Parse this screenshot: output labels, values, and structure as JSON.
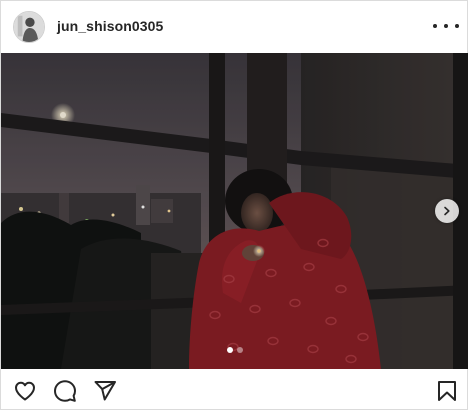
{
  "header": {
    "username": "jun_shison0305"
  },
  "icons": {
    "avatar": "avatar-photo",
    "more": "more-options-icon",
    "next": "chevron-right-icon",
    "like": "heart-icon",
    "comment": "comment-icon",
    "share": "paper-plane-icon",
    "save": "bookmark-icon"
  },
  "carousel": {
    "total_slides": 2,
    "active_slide": 1
  }
}
